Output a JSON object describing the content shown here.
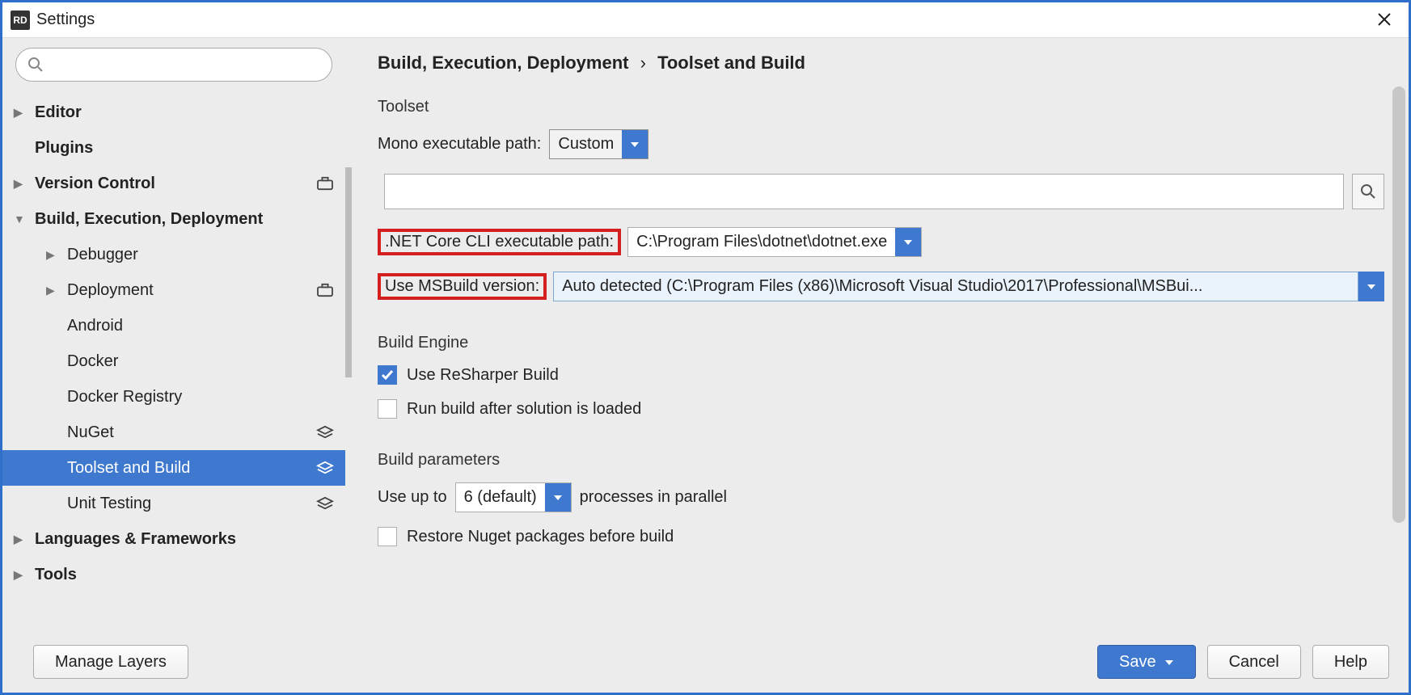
{
  "title": "Settings",
  "logo_text": "RD",
  "search": {
    "placeholder": ""
  },
  "sidebar": {
    "items": [
      {
        "label": "Editor",
        "bold": true,
        "arrow": "right",
        "indent": 0
      },
      {
        "label": "Plugins",
        "bold": true,
        "arrow": "none",
        "indent": 0
      },
      {
        "label": "Version Control",
        "bold": true,
        "arrow": "right",
        "indent": 0,
        "badge": "briefcase"
      },
      {
        "label": "Build, Execution, Deployment",
        "bold": true,
        "arrow": "down",
        "indent": 0
      },
      {
        "label": "Debugger",
        "arrow": "right",
        "indent": 1
      },
      {
        "label": "Deployment",
        "arrow": "right",
        "indent": 1,
        "badge": "briefcase"
      },
      {
        "label": "Android",
        "arrow": "none",
        "indent": 1
      },
      {
        "label": "Docker",
        "arrow": "none",
        "indent": 1
      },
      {
        "label": "Docker Registry",
        "arrow": "none",
        "indent": 1
      },
      {
        "label": "NuGet",
        "arrow": "none",
        "indent": 1,
        "badge": "layers"
      },
      {
        "label": "Toolset and Build",
        "arrow": "none",
        "indent": 1,
        "badge": "layers",
        "selected": true
      },
      {
        "label": "Unit Testing",
        "arrow": "none",
        "indent": 1,
        "badge": "layers"
      },
      {
        "label": "Languages & Frameworks",
        "bold": true,
        "arrow": "right",
        "indent": 0
      },
      {
        "label": "Tools",
        "bold": true,
        "arrow": "right",
        "indent": 0
      }
    ]
  },
  "breadcrumb": {
    "group": "Build, Execution, Deployment",
    "page": "Toolset and Build"
  },
  "toolset": {
    "section_label": "Toolset",
    "mono_label": "Mono executable path:",
    "mono_value": "Custom",
    "mono_input": "",
    "dotnet_label": ".NET Core CLI executable path:",
    "dotnet_value": "C:\\Program Files\\dotnet\\dotnet.exe",
    "msbuild_label": "Use MSBuild version:",
    "msbuild_value": "Auto detected (C:\\Program Files (x86)\\Microsoft Visual Studio\\2017\\Professional\\MSBui..."
  },
  "build_engine": {
    "section_label": "Build Engine",
    "use_resharper": "Use ReSharper Build",
    "run_after_load": "Run build after solution is loaded"
  },
  "build_params": {
    "section_label": "Build parameters",
    "use_up_to_pre": "Use up to",
    "processes_value": "6 (default)",
    "use_up_to_post": "processes in parallel",
    "restore_nuget": "Restore Nuget packages before build"
  },
  "footer": {
    "manage_layers": "Manage Layers",
    "save": "Save",
    "cancel": "Cancel",
    "help": "Help"
  }
}
